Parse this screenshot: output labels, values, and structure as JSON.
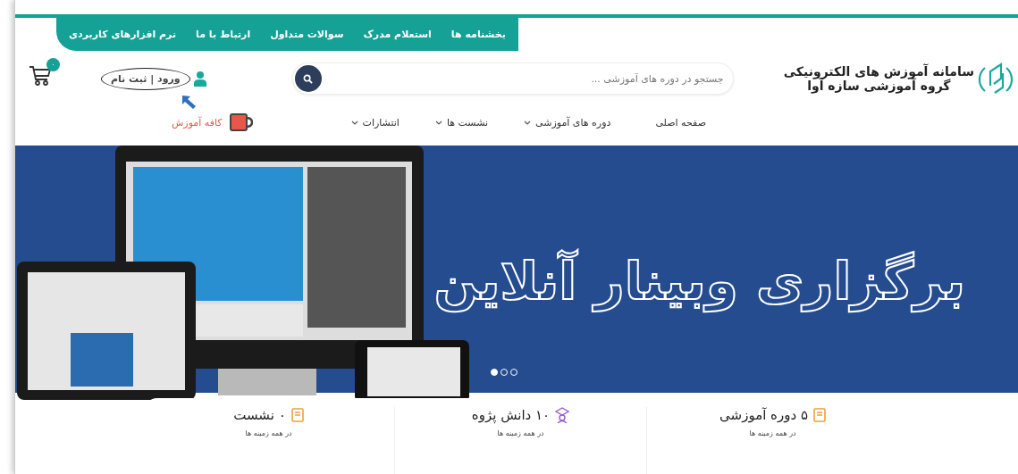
{
  "top_links": [
    {
      "label": "بخشنامه ها"
    },
    {
      "label": "استعلام مدرک"
    },
    {
      "label": "سوالات متداول"
    },
    {
      "label": "ارتباط با ما"
    },
    {
      "label": "نرم افزارهای کاربردی"
    }
  ],
  "brand": {
    "title": "سامانه آموزش های الکترونیکی",
    "subtitle": "گروه آموزشی سازه آوا"
  },
  "search": {
    "placeholder": "جستجو در دوره های آموزشی ..."
  },
  "account": {
    "label": "ورود | ثبت نام"
  },
  "cart": {
    "count": "۰"
  },
  "nav": [
    {
      "label": "صفحه اصلی",
      "dropdown": false
    },
    {
      "label": "دوره های آموزشی",
      "dropdown": true
    },
    {
      "label": "نشست ها",
      "dropdown": true
    },
    {
      "label": "انتشارات",
      "dropdown": true
    }
  ],
  "cafe": {
    "label": "کافه آموزش"
  },
  "hero": {
    "headline": "برگزاری وبینار آنلاین",
    "slides": [
      {
        "selected": true
      },
      {
        "selected": false
      },
      {
        "selected": false
      }
    ]
  },
  "stats": [
    {
      "kind": "book",
      "value": "۵ دوره آموزشی",
      "caption": "در همه زمینه ها"
    },
    {
      "kind": "student",
      "value": "۱۰ دانش پژوه",
      "caption": "در همه زمینه ها"
    },
    {
      "kind": "book",
      "value": "۰ نشست",
      "caption": "در همه زمینه ها"
    }
  ]
}
